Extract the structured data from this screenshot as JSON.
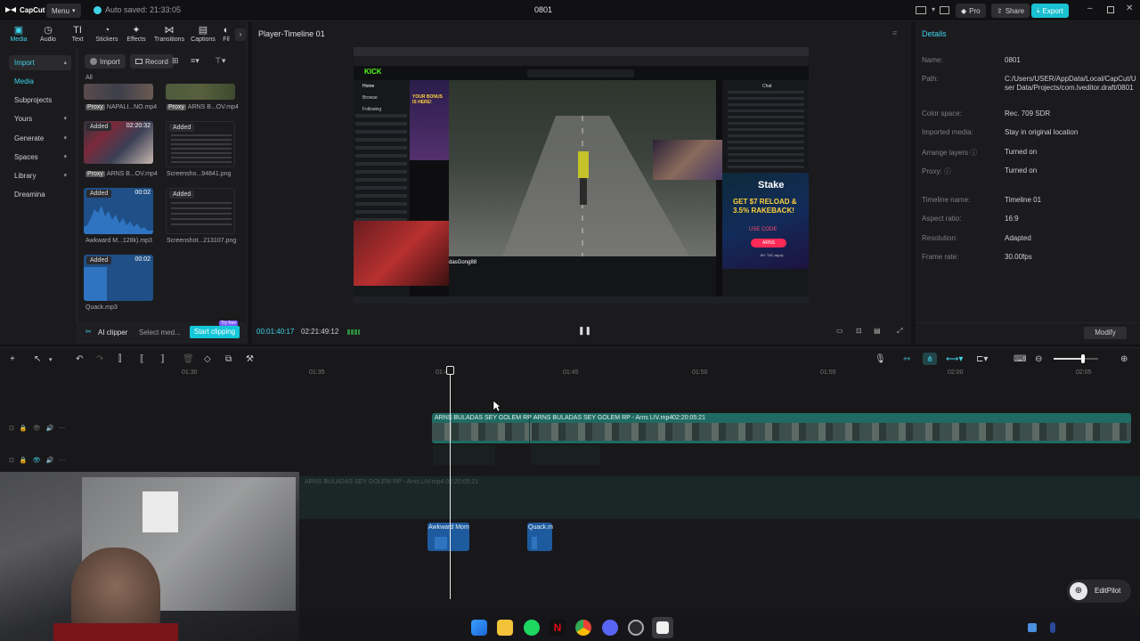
{
  "app": {
    "logo_text": "CapCut",
    "menu_label": "Menu",
    "autosave": "Auto saved: 21:33:05",
    "project_title": "0801",
    "pro_label": "Pro",
    "share_label": "Share",
    "export_label": "Export"
  },
  "toolbar": {
    "tabs": [
      "Media",
      "Audio",
      "Text",
      "Stickers",
      "Effects",
      "Transitions",
      "Captions",
      "Fil"
    ]
  },
  "sidebar": {
    "items": [
      {
        "label": "Import"
      },
      {
        "label": "Media"
      },
      {
        "label": "Subprojects"
      },
      {
        "label": "Yours"
      },
      {
        "label": "Generate"
      },
      {
        "label": "Spaces"
      },
      {
        "label": "Library"
      },
      {
        "label": "Dreamina"
      }
    ]
  },
  "media": {
    "import_label": "Import",
    "record_label": "Record",
    "filter_label": "All",
    "items": [
      {
        "name": "NAPALI...NO.mp4",
        "proxy": "Proxy",
        "tag": "",
        "duration": ""
      },
      {
        "name": "ARNS B...OV.mp4",
        "proxy": "Proxy",
        "tag": "",
        "duration": ""
      },
      {
        "name": "ARNS B...OV.mp4",
        "proxy": "Proxy",
        "tag": "Added",
        "duration": "02:20:32"
      },
      {
        "name": "Screensho...94841.png",
        "proxy": "",
        "tag": "Added",
        "duration": ""
      },
      {
        "name": "Awkward M...128k).mp3",
        "proxy": "",
        "tag": "Added",
        "duration": "00:02"
      },
      {
        "name": "Screenshot...213107.png",
        "proxy": "",
        "tag": "Added",
        "duration": ""
      },
      {
        "name": "Quack.mp3",
        "proxy": "",
        "tag": "Added",
        "duration": "00:02"
      }
    ],
    "ai_clipper": "AI clipper",
    "select_media": "Select med...",
    "start_clipping": "Start clipping",
    "try_free": "Try free"
  },
  "player": {
    "title": "Player-Timeline 01",
    "current_time": "00:01:40:17",
    "total_time": "02:21:49:12",
    "stream": {
      "site_logo": "KICK",
      "chat_header": "Chat",
      "nav": [
        "Home",
        "Browse",
        "Following"
      ],
      "streamer": "dasGong88",
      "promo_brand": "Stake",
      "promo_text": "GET $7 RELOAD & 3.5% RAKEBACK!",
      "promo_use_code": "USE CODE",
      "promo_code": "ARNS",
      "promo_note": "18+ T&C apply",
      "left_banner": "YOUR BONUS IS HERE!"
    }
  },
  "details": {
    "title": "Details",
    "rows": [
      {
        "key": "Name:",
        "value": "0801"
      },
      {
        "key": "Path:",
        "value": "C:/Users/USER/AppData/Local/CapCut/User Data/Projects/com.lveditor.draft/0801"
      },
      {
        "key": "Color space:",
        "value": "Rec. 709 SDR"
      },
      {
        "key": "Imported media:",
        "value": "Stay in original location"
      },
      {
        "key": "Arrange layers",
        "value": "Turned on"
      },
      {
        "key": "Proxy:",
        "value": "Turned on"
      },
      {
        "key": "Timeline name:",
        "value": "Timeline 01"
      },
      {
        "key": "Aspect ratio:",
        "value": "16:9"
      },
      {
        "key": "Resolution:",
        "value": "Adapted"
      },
      {
        "key": "Frame rate:",
        "value": "30.00fps"
      }
    ],
    "modify_label": "Modify"
  },
  "timeline": {
    "ruler": [
      "01:30",
      "01:35",
      "01:40",
      "01:45",
      "01:50",
      "01:55",
      "02:00",
      "02:05"
    ],
    "main_clip_1": "ARNS BULADAS SEY GOLEM RP -",
    "main_clip_2": "ARNS BULADAS SEY GOLEM RP - Arns LIV.mp4",
    "main_clip_duration": "02:20:05:21",
    "audio_clip_1": "Awkward Mom",
    "audio_clip_2": "Quack.m",
    "ghost_text": "ARNS BULADAS SEY GOLEM RP - Arns LIV.mp4 02:20:05:21"
  },
  "editpilot": {
    "label": "EditPilot"
  },
  "colors": {
    "accent": "#3fd3e8",
    "clip_green": "#1f6b63",
    "audio_blue": "#1e5a9e",
    "export_bg": "#19c1d1",
    "start_clip_bg": "#14c7d7"
  }
}
